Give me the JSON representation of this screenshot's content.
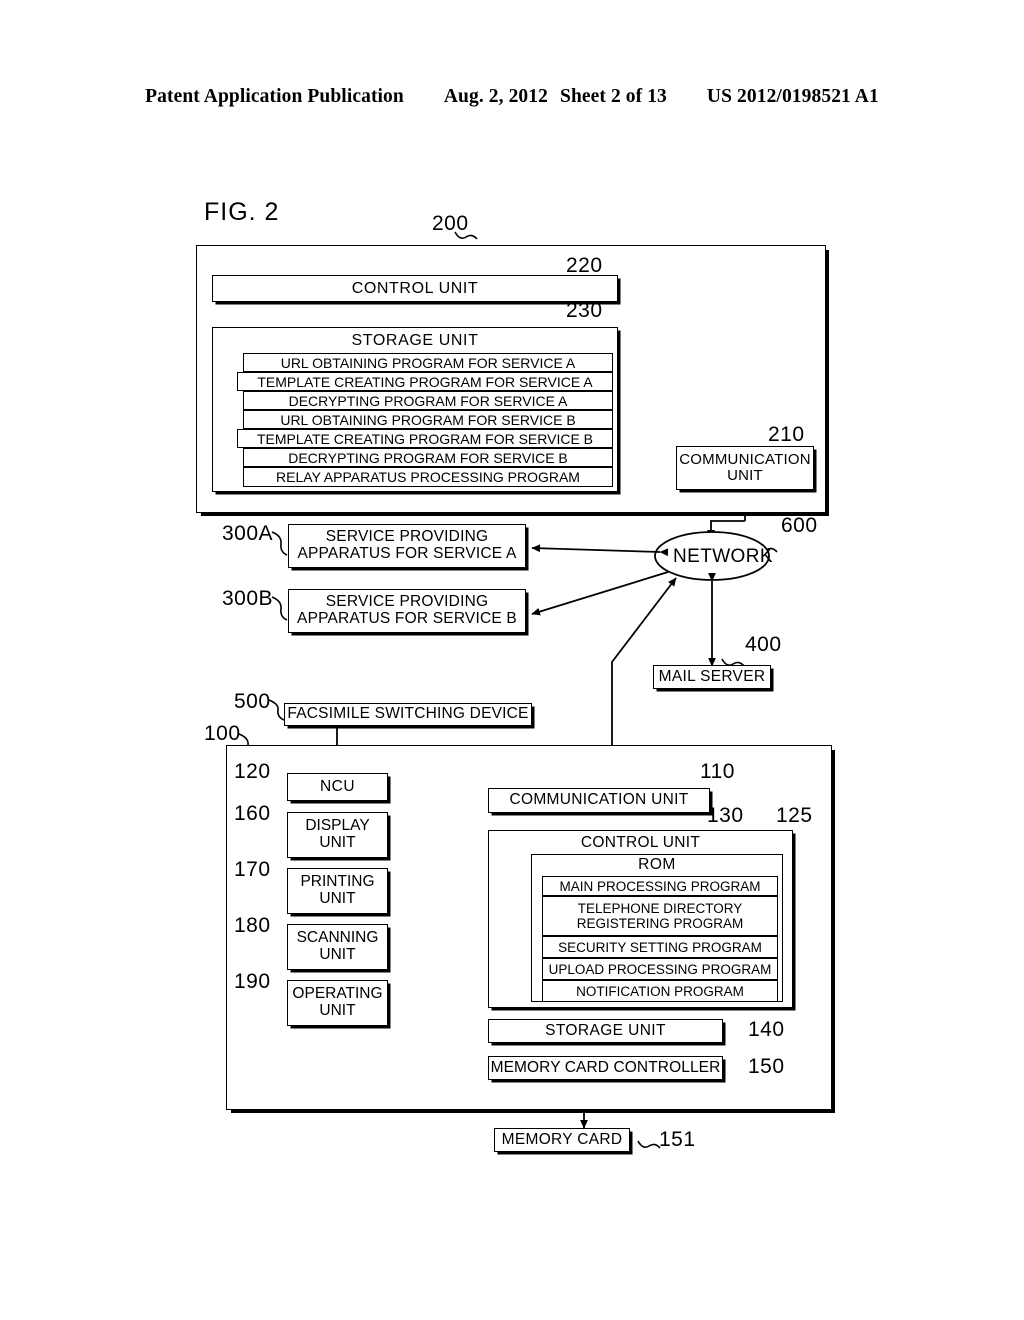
{
  "header": {
    "publication": "Patent Application Publication",
    "date": "Aug. 2, 2012",
    "sheet": "Sheet 2 of 13",
    "number": "US 2012/0198521 A1"
  },
  "figure": {
    "title": "FIG. 2"
  },
  "relay_apparatus": {
    "ref": "200",
    "control_unit": {
      "label": "CONTROL UNIT",
      "ref": "220"
    },
    "storage_unit": {
      "label": "STORAGE  UNIT",
      "ref": "230",
      "programs": [
        "URL OBTAINING PROGRAM FOR SERVICE A",
        "TEMPLATE CREATING PROGRAM FOR SERVICE A",
        "DECRYPTING PROGRAM FOR SERVICE A",
        "URL OBTAINING PROGRAM FOR SERVICE B",
        "TEMPLATE CREATING PROGRAM FOR SERVICE B",
        "DECRYPTING PROGRAM FOR SERVICE B",
        "RELAY APPARATUS PROCESSING PROGRAM"
      ]
    },
    "communication_unit": {
      "line1": "COMMUNICATION",
      "line2": "UNIT",
      "ref": "210"
    }
  },
  "network": {
    "label": "NETWORK",
    "ref": "600"
  },
  "service_a": {
    "line1": "SERVICE PROVIDING",
    "line2": "APPARATUS FOR SERVICE A",
    "ref": "300A"
  },
  "service_b": {
    "line1": "SERVICE PROVIDING",
    "line2": "APPARATUS FOR SERVICE B",
    "ref": "300B"
  },
  "mail_server": {
    "label": "MAIL SERVER",
    "ref": "400"
  },
  "fax_switch": {
    "label": "FACSIMILE SWITCHING DEVICE",
    "ref": "500"
  },
  "device": {
    "ref": "100",
    "ncu": {
      "label": "NCU",
      "ref": "120"
    },
    "display_unit": {
      "line1": "DISPLAY",
      "line2": "UNIT",
      "ref": "160"
    },
    "printing_unit": {
      "line1": "PRINTING",
      "line2": "UNIT",
      "ref": "170"
    },
    "scanning_unit": {
      "line1": "SCANNING",
      "line2": "UNIT",
      "ref": "180"
    },
    "operating_unit": {
      "line1": "OPERATING",
      "line2": "UNIT",
      "ref": "190"
    },
    "communication_unit": {
      "label": "COMMUNICATION UNIT",
      "ref": "110"
    },
    "control_unit": {
      "label": "CONTROL UNIT",
      "ref": "130"
    },
    "rom": {
      "label": "ROM",
      "ref": "125",
      "programs": [
        "MAIN PROCESSING PROGRAM",
        "TELEPHONE DIRECTORY\nREGISTERING PROGRAM",
        "SECURITY SETTING PROGRAM",
        "UPLOAD PROCESSING PROGRAM",
        "NOTIFICATION PROGRAM"
      ],
      "programs_display": [
        "MAIN PROCESSING PROGRAM",
        "TELEPHONE DIRECTORY REGISTERING PROGRAM",
        "SECURITY SETTING PROGRAM",
        "UPLOAD PROCESSING PROGRAM",
        "NOTIFICATION PROGRAM"
      ],
      "program2_line1": "TELEPHONE DIRECTORY",
      "program2_line2": "REGISTERING PROGRAM"
    },
    "storage_unit": {
      "label": "STORAGE UNIT",
      "ref": "140"
    },
    "memory_card_controller": {
      "label": "MEMORY CARD CONTROLLER",
      "ref": "150"
    }
  },
  "memory_card": {
    "label": "MEMORY CARD",
    "ref": "151"
  },
  "colors": {
    "ink": "#000000",
    "paper": "#ffffff"
  }
}
